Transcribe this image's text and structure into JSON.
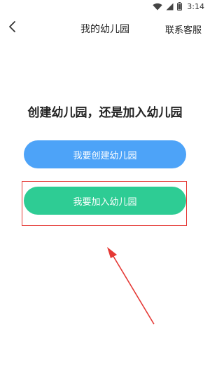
{
  "status_bar": {
    "time": "3:14",
    "icons": [
      "wifi-icon",
      "cell-signal-icon",
      "battery-icon"
    ]
  },
  "header": {
    "back_icon": "chevron-left-icon",
    "title": "我的幼儿园",
    "contact_label": "联系客服"
  },
  "main": {
    "question": "创建幼儿园，还是加入幼儿园",
    "create_button": "我要创建幼儿园",
    "join_button": "我要加入幼儿园"
  },
  "annotation": {
    "type": "highlight-and-arrow"
  },
  "colors": {
    "create_button": "#4da3f8",
    "join_button": "#2ecc94",
    "annotation": "#e53935"
  }
}
